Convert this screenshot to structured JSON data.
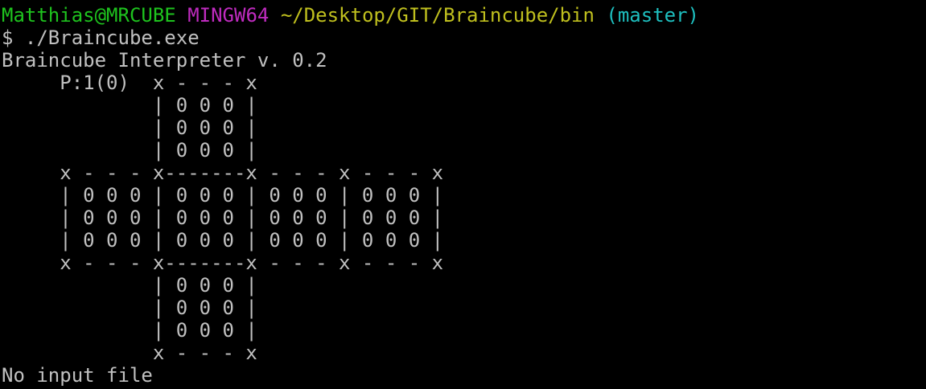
{
  "prompt": {
    "user_host": "Matthias@MRCUBE",
    "system": "MINGW64",
    "cwd": "~/Desktop/GIT/Braincube/bin",
    "branch": "(master)"
  },
  "command": {
    "prompt_symbol": "$",
    "text": "./Braincube.exe"
  },
  "output": {
    "banner": "Braincube Interpreter v. 0.2",
    "cube_lines": [
      "     P:1(0)  x - - - x",
      "             | 0 0 0 |",
      "             | 0 0 0 |",
      "             | 0 0 0 |",
      "     x - - - x-------x - - - x - - - x",
      "     | 0 0 0 | 0 0 0 | 0 0 0 | 0 0 0 |",
      "     | 0 0 0 | 0 0 0 | 0 0 0 | 0 0 0 |",
      "     | 0 0 0 | 0 0 0 | 0 0 0 | 0 0 0 |",
      "     x - - - x-------x - - - x - - - x",
      "             | 0 0 0 |",
      "             | 0 0 0 |",
      "             | 0 0 0 |",
      "             x - - - x"
    ],
    "message": "No input file"
  },
  "colors": {
    "background": "#000000",
    "text": "#c0c0c0",
    "user_host": "#1ec31e",
    "system": "#bf2bbf",
    "cwd": "#bfbf1e",
    "branch": "#1ebfbf"
  }
}
